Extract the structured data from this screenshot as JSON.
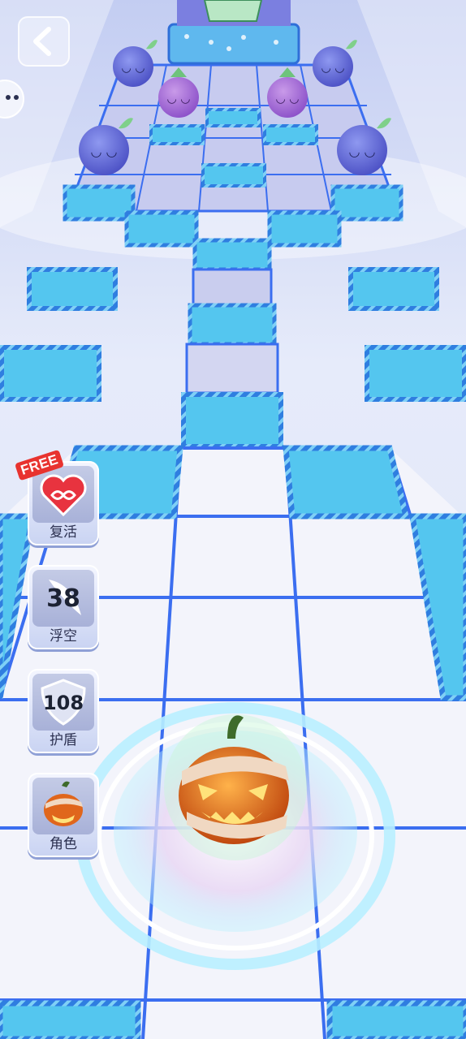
{
  "side_buttons": {
    "revive": {
      "label": "复活",
      "badge": "FREE",
      "icon": "infinity-heart-icon"
    },
    "float": {
      "label": "浮空",
      "count": "38",
      "icon": "wing-icon"
    },
    "shield": {
      "label": "护盾",
      "count": "108",
      "icon": "shield-icon"
    },
    "character": {
      "label": "角色",
      "icon": "pumpkin-character-icon"
    }
  },
  "top_controls": {
    "back": {
      "icon": "back-arrow-icon"
    },
    "chat": {
      "icon": "emoji-face-icon"
    }
  },
  "colors": {
    "tile_blue": "#54c6ef",
    "tile_white": "#f3f4fb",
    "tile_lavender": "#c6c9ec",
    "grid_line": "#3b6ef0",
    "enemy_blue": "#6470dd",
    "enemy_purple": "#a86cd8",
    "pumpkin": "#e0661c"
  }
}
